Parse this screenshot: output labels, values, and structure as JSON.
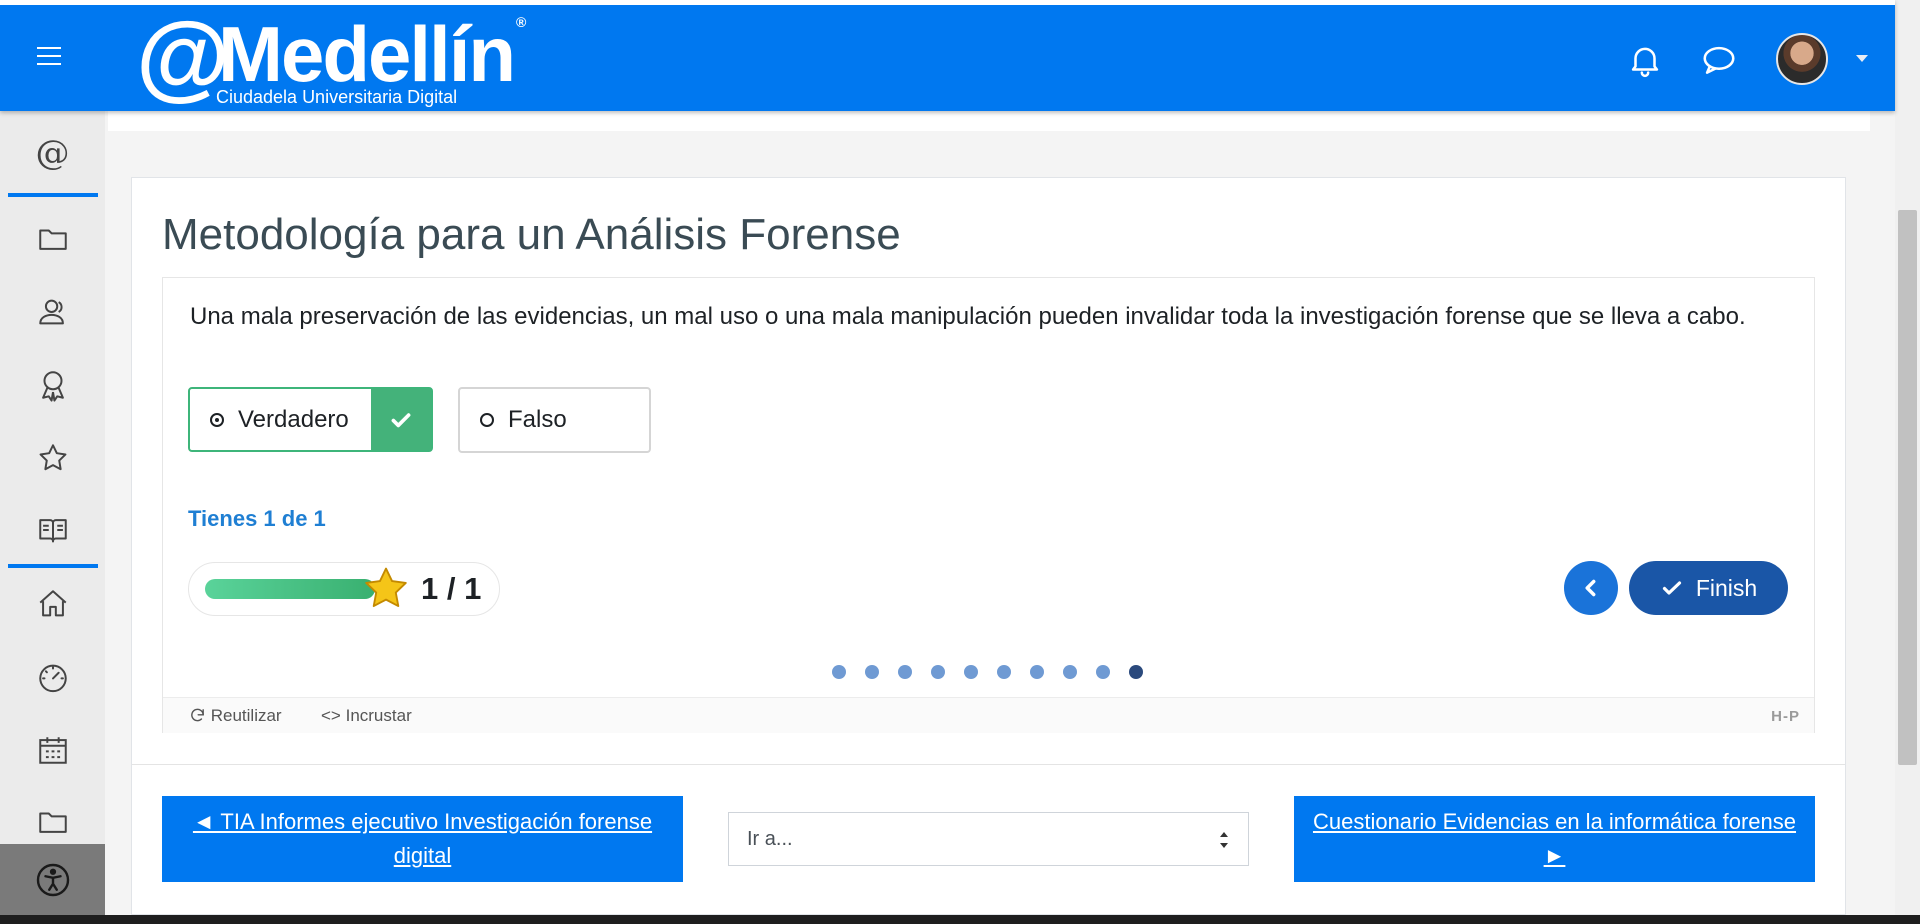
{
  "header": {
    "logo_text": "@Medellín",
    "logo_mark": "®",
    "logo_subtitle": "Ciudadela Universitaria Digital",
    "icons": [
      "menu-icon",
      "bell-icon",
      "chat-icon",
      "user-avatar",
      "chevron-down-icon"
    ]
  },
  "sidebar": {
    "items": [
      {
        "icon": "at-icon",
        "name": "sidebar-item-home-at"
      },
      {
        "icon": "folder-icon",
        "name": "sidebar-item-files"
      },
      {
        "icon": "user-icon",
        "name": "sidebar-item-participants"
      },
      {
        "icon": "award-icon",
        "name": "sidebar-item-badges"
      },
      {
        "icon": "star-icon",
        "name": "sidebar-item-favorites"
      },
      {
        "icon": "book-icon",
        "name": "sidebar-item-grades"
      },
      {
        "icon": "home-icon",
        "name": "sidebar-item-home"
      },
      {
        "icon": "dashboard-icon",
        "name": "sidebar-item-dashboard"
      },
      {
        "icon": "calendar-icon",
        "name": "sidebar-item-calendar"
      },
      {
        "icon": "folder-icon",
        "name": "sidebar-item-private-files"
      }
    ],
    "accessibility_icon": "accessibility-icon"
  },
  "main": {
    "title": "Metodología para un Análisis Forense",
    "question": "Una mala preservación de las evidencias, un mal uso o una mala manipulación pueden invalidar toda la investigación forense que se lleva a cabo.",
    "options": [
      {
        "label": "Verdadero",
        "selected": true,
        "correct": true
      },
      {
        "label": "Falso",
        "selected": false
      }
    ],
    "score_text": "Tienes 1 de 1",
    "progress": {
      "current": 1,
      "total": 1,
      "fraction": 1.0,
      "display": "1 / 1"
    },
    "finish_label": "Finish",
    "slides": {
      "count": 10,
      "active_index": 9
    },
    "footer": {
      "reuse_label": "Reutilizar",
      "embed_label": "Incrustar",
      "h5p_logo": "H-P"
    }
  },
  "navigation": {
    "prev_link": "◄ TIA Informes ejecutivo Investigación forense digital",
    "jump_placeholder": "Ir a...",
    "next_link": "Cuestionario Evidencias en la informática forense ►"
  },
  "colors": {
    "brand": "#0078f0",
    "correct": "#44b27a",
    "score": "#1f7fd3",
    "finish": "#1a56a7"
  }
}
